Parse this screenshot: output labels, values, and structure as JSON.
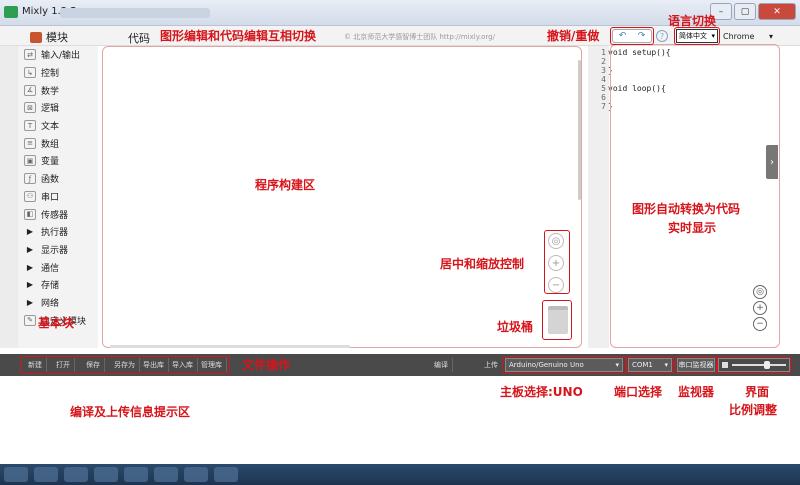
{
  "window": {
    "title": "Mixly 1.2.5",
    "controls": [
      "–",
      "▢",
      "✕"
    ]
  },
  "toolbar": {
    "blocks_tab": "模块",
    "code_tab": "代码",
    "note": "© 北京师范大学感智博士团队 http://mixly.org/",
    "undo_icon": "undo-icon",
    "redo_icon": "redo-icon",
    "help_icon": "?",
    "language": "简体中文",
    "browser": "Chrome"
  },
  "sidebar": {
    "items": [
      {
        "label": "输入/输出",
        "icon": "io-icon",
        "expandable": false
      },
      {
        "label": "控制",
        "icon": "control-icon",
        "expandable": false
      },
      {
        "label": "数学",
        "icon": "math-icon",
        "expandable": false
      },
      {
        "label": "逻辑",
        "icon": "logic-icon",
        "expandable": false
      },
      {
        "label": "文本",
        "icon": "text-icon",
        "expandable": false
      },
      {
        "label": "数组",
        "icon": "array-icon",
        "expandable": false
      },
      {
        "label": "变量",
        "icon": "variable-icon",
        "expandable": false
      },
      {
        "label": "函数",
        "icon": "function-icon",
        "expandable": false
      },
      {
        "label": "串口",
        "icon": "serial-icon",
        "expandable": false
      },
      {
        "label": "传感器",
        "icon": "sensor-icon",
        "expandable": false
      },
      {
        "label": "执行器",
        "icon": "triangle",
        "expandable": true
      },
      {
        "label": "显示器",
        "icon": "triangle",
        "expandable": true
      },
      {
        "label": "通信",
        "icon": "triangle",
        "expandable": true
      },
      {
        "label": "存储",
        "icon": "triangle",
        "expandable": true
      },
      {
        "label": "网络",
        "icon": "triangle",
        "expandable": true
      },
      {
        "label": "自定义模块",
        "icon": "custom-icon",
        "expandable": false
      }
    ]
  },
  "editor": {
    "lines": [
      {
        "num": "1",
        "text": "void setup(){"
      },
      {
        "num": "2",
        "text": ""
      },
      {
        "num": "3",
        "text": "}"
      },
      {
        "num": "4",
        "text": ""
      },
      {
        "num": "5",
        "text": "void loop(){"
      },
      {
        "num": "6",
        "text": ""
      },
      {
        "num": "7",
        "text": "}"
      }
    ]
  },
  "bottombar": {
    "file_buttons": [
      "新建",
      "打开",
      "保存",
      "另存为",
      "导出库",
      "导入库",
      "管理库"
    ],
    "compile": "编译",
    "upload": "上传",
    "board": "Arduino/Genuino Uno",
    "port": "COM1",
    "monitor": "串口监视器"
  },
  "annotations": {
    "switch": "图形编辑和代码编辑互相切换",
    "undo_redo": "撤销/重做",
    "language": "语言切换",
    "workspace": "程序构建区",
    "auto_convert_1": "图形自动转换为代码",
    "auto_convert_2": "实时显示",
    "zoom": "居中和缩放控制",
    "trash": "垃圾桶",
    "blocks": "基本块",
    "file_ops": "文件操作",
    "board": "主板选择:UNO",
    "port": "端口选择",
    "monitor": "监视器",
    "scale_1": "界面",
    "scale_2": "比例调整",
    "messages": "编译及上传信息提示区"
  }
}
